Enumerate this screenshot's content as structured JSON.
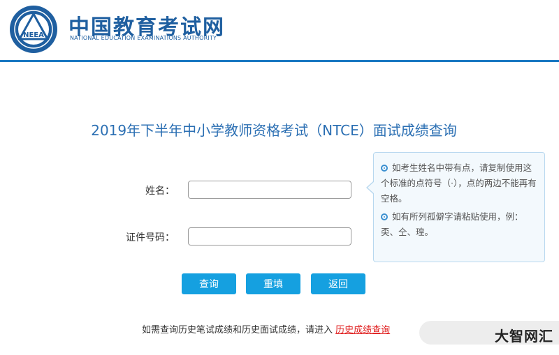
{
  "header": {
    "site_name": "中国教育考试网",
    "site_name_en": "NATIONAL EDUCATION EXAMINATIONS AUTHORITY",
    "logo_text": "NEEA",
    "accent_color": "#1a78c2"
  },
  "title": "2019年下半年中小学教师资格考试（NTCE）面试成绩查询",
  "form": {
    "name_label": "姓名：",
    "name_value": "",
    "id_label": "证件号码：",
    "id_value": ""
  },
  "tips": [
    "如考生姓名中带有点，请复制使用这个标准的点符号（·），点的两边不能再有空格。",
    "如有所列孤僻字请粘贴使用，例：奀、仝、瑝。"
  ],
  "buttons": {
    "query": "查询",
    "reset": "重填",
    "back": "返回",
    "color": "#15a0e0"
  },
  "history": {
    "text": "如需查询历史笔试成绩和历史面试成绩，请进入",
    "link": "历史成绩查询",
    "link_color": "#e02020"
  },
  "watermark": "大智网汇"
}
